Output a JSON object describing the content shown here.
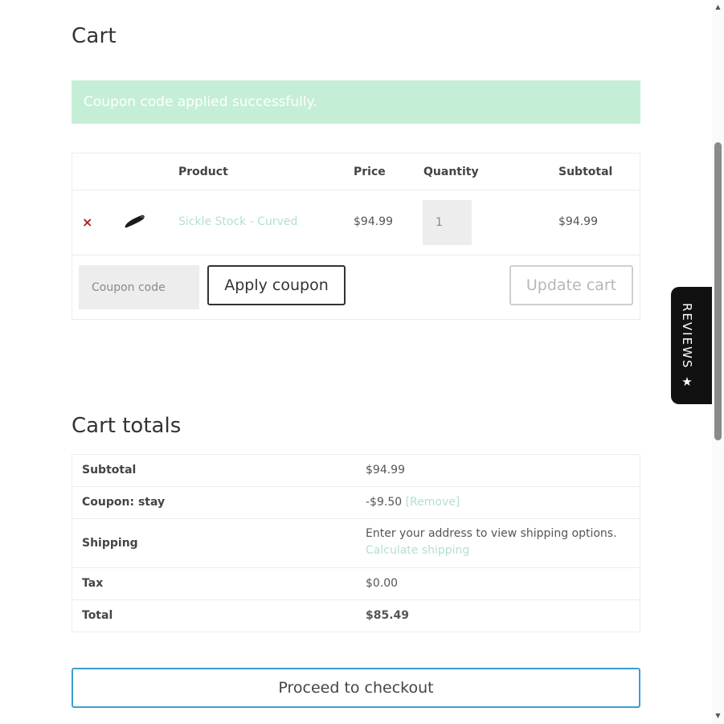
{
  "page": {
    "title": "Cart"
  },
  "notice": {
    "text": "Coupon code applied successfully."
  },
  "cart": {
    "headers": {
      "product": "Product",
      "price": "Price",
      "quantity": "Quantity",
      "subtotal": "Subtotal"
    },
    "items": [
      {
        "remove_symbol": "×",
        "thumbnail_icon": "product-thumbnail",
        "name": "Sickle Stock - Curved",
        "price": "$94.99",
        "quantity": "1",
        "subtotal": "$94.99"
      }
    ],
    "coupon_placeholder": "Coupon code",
    "apply_label": "Apply coupon",
    "update_label": "Update cart"
  },
  "totals": {
    "title": "Cart totals",
    "subtotal_label": "Subtotal",
    "subtotal_value": "$94.99",
    "coupon_label": "Coupon: stay",
    "coupon_value": "-$9.50",
    "coupon_remove": "[Remove]",
    "shipping_label": "Shipping",
    "shipping_text": "Enter your address to view shipping options.",
    "shipping_link": "Calculate shipping",
    "tax_label": "Tax",
    "tax_value": "$0.00",
    "total_label": "Total",
    "total_value": "$85.49"
  },
  "checkout": {
    "label": "Proceed to checkout"
  },
  "reviews_tab": {
    "label": "REVIEWS ★"
  },
  "colors": {
    "notice_bg": "#c5eed6",
    "link": "#b3e0d0",
    "remove": "#b01d1d",
    "checkout_border": "#3a9fd1",
    "reviews_bg": "#111111"
  }
}
